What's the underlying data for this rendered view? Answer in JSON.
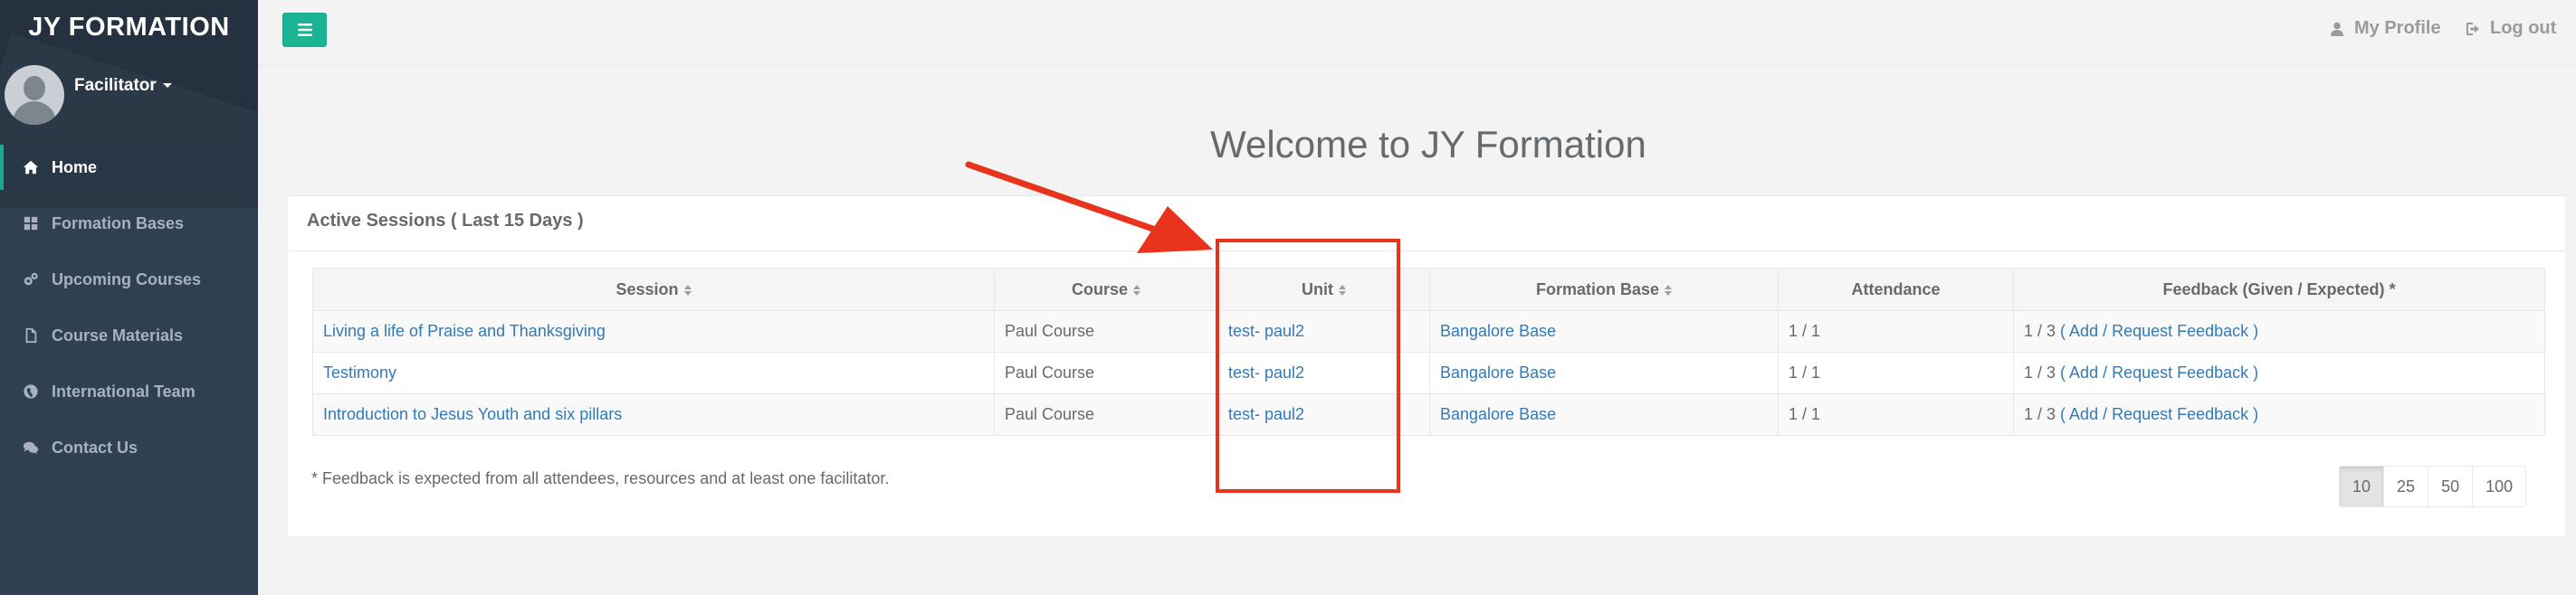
{
  "brand": "JY FORMATION",
  "user": {
    "role": "Facilitator"
  },
  "sidebar": {
    "items": [
      {
        "label": "Home",
        "icon": "home-icon",
        "active": true
      },
      {
        "label": "Formation Bases",
        "icon": "grid-icon",
        "active": false
      },
      {
        "label": "Upcoming Courses",
        "icon": "cogs-icon",
        "active": false
      },
      {
        "label": "Course Materials",
        "icon": "file-icon",
        "active": false
      },
      {
        "label": "International Team",
        "icon": "globe-icon",
        "active": false
      },
      {
        "label": "Contact Us",
        "icon": "comments-icon",
        "active": false
      }
    ]
  },
  "topbar": {
    "menu_icon": "bars-icon",
    "profile_label": "My Profile",
    "logout_label": "Log out"
  },
  "main": {
    "welcome": "Welcome to JY Formation",
    "panel_title": "Active Sessions ( Last 15 Days )",
    "columns": [
      "Session",
      "Course",
      "Unit",
      "Formation Base",
      "Attendance",
      "Feedback (Given / Expected) *"
    ],
    "rows": [
      {
        "session": "Living a life of Praise and Thanksgiving",
        "course": "Paul Course",
        "unit": "test- paul2",
        "base": "Bangalore Base",
        "attendance": "1 / 1",
        "feedback_count": "1 / 3",
        "feedback_link": "( Add / Request Feedback )"
      },
      {
        "session": "Testimony",
        "course": "Paul Course",
        "unit": "test- paul2",
        "base": "Bangalore Base",
        "attendance": "1 / 1",
        "feedback_count": "1 / 3",
        "feedback_link": "( Add / Request Feedback )"
      },
      {
        "session": "Introduction to Jesus Youth and six pillars",
        "course": "Paul Course",
        "unit": "test- paul2",
        "base": "Bangalore Base",
        "attendance": "1 / 1",
        "feedback_count": "1 / 3",
        "feedback_link": "( Add / Request Feedback )"
      }
    ],
    "footnote": "* Feedback is expected from all attendees, resources and at least one facilitator.",
    "page_sizes": [
      "10",
      "25",
      "50",
      "100"
    ],
    "selected_page_size": "10"
  },
  "colors": {
    "sidebar_bg": "#2f4050",
    "accent": "#1ab394",
    "link": "#337ab7",
    "annotation": "#e8341c"
  }
}
